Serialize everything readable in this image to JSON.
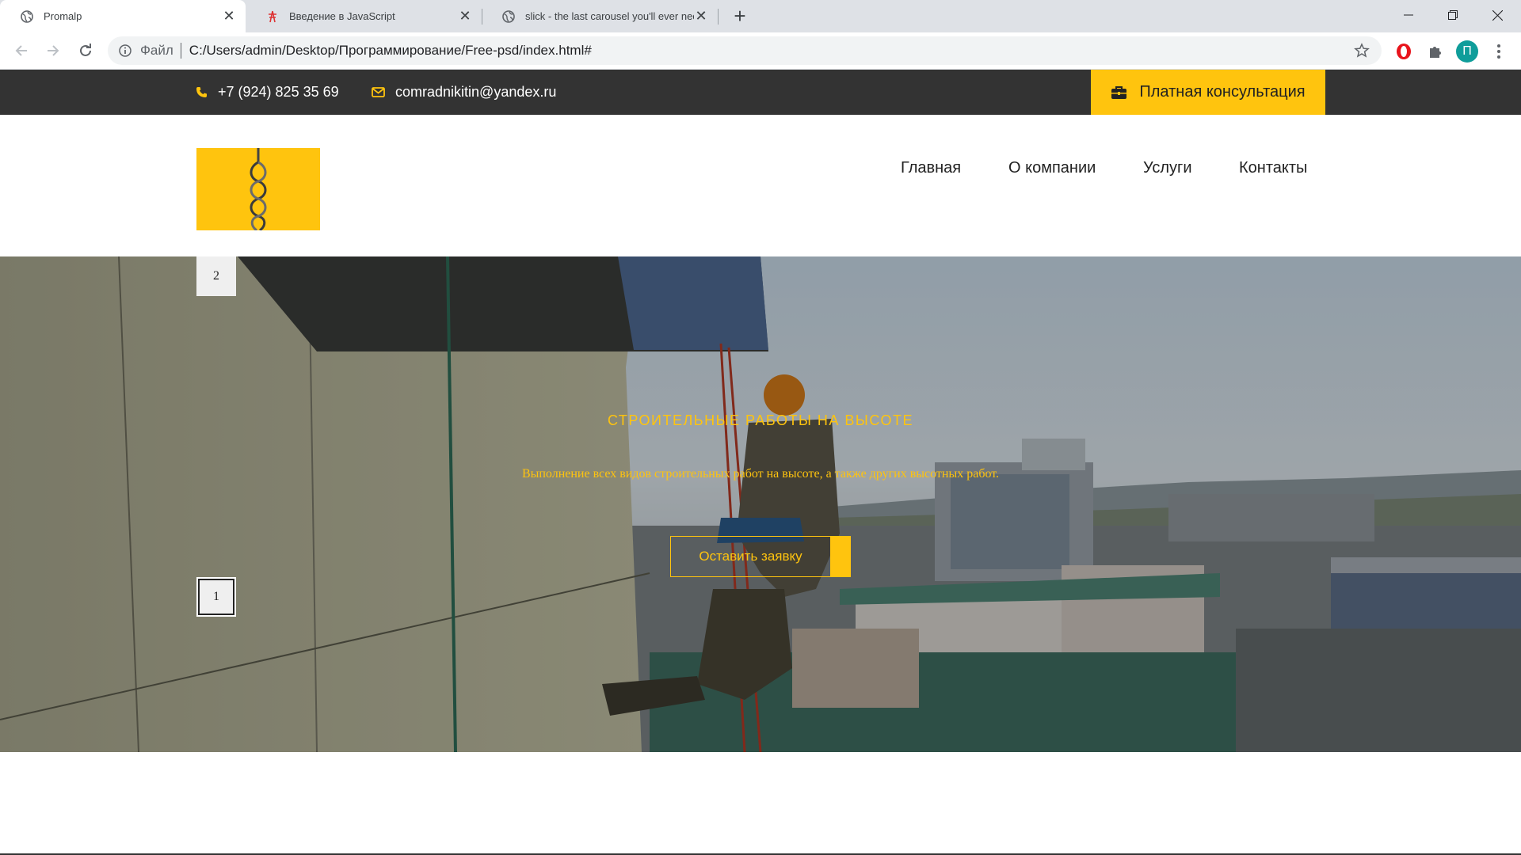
{
  "browser": {
    "tabs": [
      {
        "title": "Promalp",
        "active": true
      },
      {
        "title": "Введение в JavaScript",
        "active": false
      },
      {
        "title": "slick - the last carousel you'll ever need",
        "active": false
      }
    ],
    "omnibox": {
      "scheme_label": "Файл",
      "url": "C:/Users/admin/Desktop/Программирование/Free-psd/index.html#"
    },
    "profile_initial": "П"
  },
  "site": {
    "topbar": {
      "phone": "+7 (924) 825 35 69",
      "email": "comradnikitin@yandex.ru",
      "consult_label": "Платная консультация"
    },
    "nav": [
      "Главная",
      "О компании",
      "Услуги",
      "Контакты"
    ],
    "hero": {
      "title": "СТРОИТЕЛЬНЫЕ РАБОТЫ НА ВЫСОТЕ",
      "subtitle": "Выполнение всех видов строительных работ на высоте, а также других высотных работ.",
      "button_label": "Оставить заявку",
      "dots": [
        "2",
        "1"
      ]
    }
  },
  "colors": {
    "accent": "#ffc40e",
    "topbar_bg": "#333333"
  }
}
